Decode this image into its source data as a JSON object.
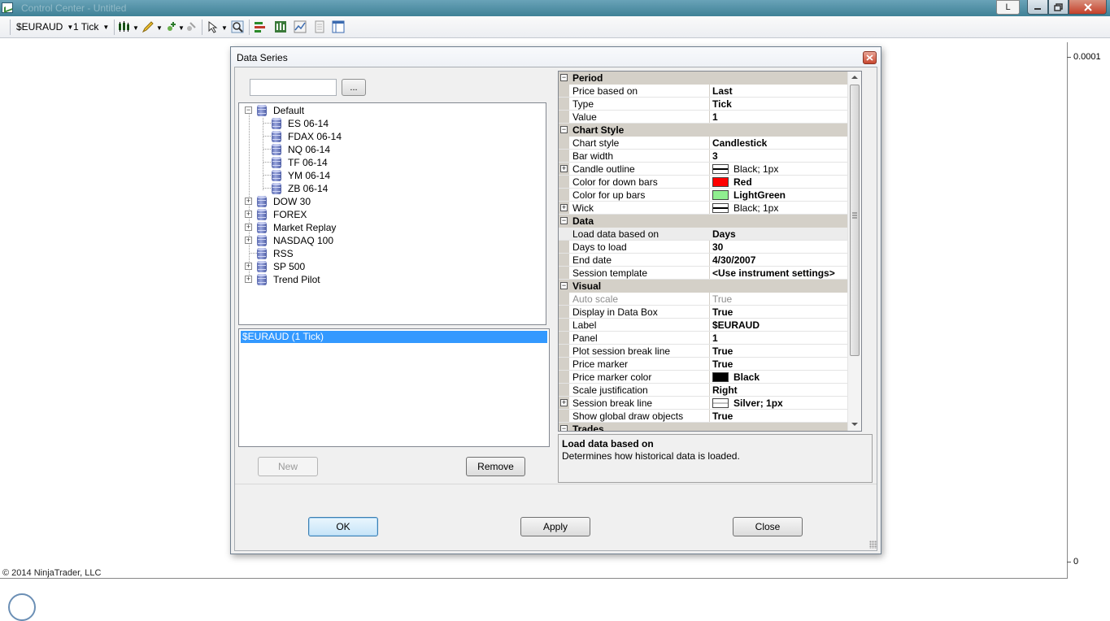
{
  "window": {
    "title": "Control Center - Untitled",
    "layout_button": "L"
  },
  "toolbar": {
    "instrument": "$EURAUD",
    "interval": "1 Tick"
  },
  "chart": {
    "axis_top_label": "0.0001",
    "axis_bottom_label": "0",
    "copyright": "© 2014 NinjaTrader, LLC"
  },
  "dialog": {
    "title": "Data Series",
    "browse_label": "...",
    "search_value": "",
    "tree": [
      {
        "label": "Default",
        "expanded": true,
        "children": [
          "ES 06-14",
          "FDAX 06-14",
          "NQ 06-14",
          "TF 06-14",
          "YM 06-14",
          "ZB 06-14"
        ]
      },
      {
        "label": "DOW 30",
        "expanded": false
      },
      {
        "label": "FOREX",
        "expanded": false
      },
      {
        "label": "Market Replay",
        "expanded": false
      },
      {
        "label": "NASDAQ 100",
        "expanded": false
      },
      {
        "label": "RSS",
        "expanded": null
      },
      {
        "label": "SP 500",
        "expanded": false
      },
      {
        "label": "Trend Pilot",
        "expanded": false
      }
    ],
    "series": [
      "$EURAUD (1 Tick)"
    ],
    "buttons": {
      "new": "New",
      "remove": "Remove",
      "ok": "OK",
      "apply": "Apply",
      "close": "Close"
    },
    "properties": {
      "period": {
        "label": "Period",
        "rows": [
          {
            "name": "Price based on",
            "value": "Last"
          },
          {
            "name": "Type",
            "value": "Tick"
          },
          {
            "name": "Value",
            "value": "1"
          }
        ]
      },
      "chart_style": {
        "label": "Chart Style",
        "rows": [
          {
            "name": "Chart style",
            "value": "Candlestick"
          },
          {
            "name": "Bar width",
            "value": "3"
          },
          {
            "name": "Candle outline",
            "value": "Black; 1px",
            "color": "#000000"
          },
          {
            "name": "Color for down bars",
            "value": "Red",
            "color": "#ff0000"
          },
          {
            "name": "Color for up bars",
            "value": "LightGreen",
            "color": "#90ee90"
          },
          {
            "name": "Wick",
            "value": "Black; 1px",
            "color": "#000000"
          }
        ]
      },
      "data": {
        "label": "Data",
        "rows": [
          {
            "name": "Load data based on",
            "value": "Days"
          },
          {
            "name": "Days to load",
            "value": "30"
          },
          {
            "name": "End date",
            "value": "4/30/2007"
          },
          {
            "name": "Session template",
            "value": "<Use instrument settings>"
          }
        ]
      },
      "visual": {
        "label": "Visual",
        "rows": [
          {
            "name": "Auto scale",
            "value": "True"
          },
          {
            "name": "Display in Data Box",
            "value": "True"
          },
          {
            "name": "Label",
            "value": "$EURAUD"
          },
          {
            "name": "Panel",
            "value": "1"
          },
          {
            "name": "Plot session break line",
            "value": "True"
          },
          {
            "name": "Price marker",
            "value": "True"
          },
          {
            "name": "Price marker color",
            "value": "Black",
            "color": "#000000"
          },
          {
            "name": "Scale justification",
            "value": "Right"
          },
          {
            "name": "Session break line",
            "value": "Silver; 1px",
            "color": "#c0c0c0"
          },
          {
            "name": "Show global draw objects",
            "value": "True"
          }
        ]
      },
      "trades": {
        "label": "Trades"
      }
    },
    "help": {
      "title": "Load data based on",
      "description": "Determines how historical data is loaded."
    }
  }
}
